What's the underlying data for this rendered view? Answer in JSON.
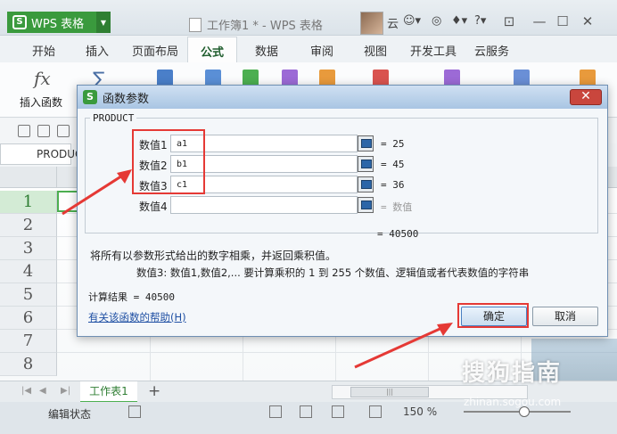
{
  "app": {
    "name": "WPS 表格",
    "window_title": "工作簿1 * - WPS 表格",
    "user_initial": "云"
  },
  "ribbon_tabs": [
    "开始",
    "插入",
    "页面布局",
    "公式",
    "数据",
    "审阅",
    "视图",
    "开发工具",
    "云服务"
  ],
  "active_tab": "公式",
  "ribbon": {
    "insert_function_label": "插入函数"
  },
  "name_box": "PRODUC",
  "rows": [
    "1",
    "2",
    "3",
    "4",
    "5",
    "6",
    "7",
    "8"
  ],
  "sheet_tab": "工作表1",
  "status": {
    "mode": "编辑状态",
    "zoom": "150 %"
  },
  "watermark": {
    "brand": "搜狗指南",
    "url": "zhinan.sogou.com"
  },
  "dialog": {
    "title": "函数参数",
    "function_name": "PRODUCT",
    "args": [
      {
        "label": "数值1",
        "value": "a1",
        "result": "= 25"
      },
      {
        "label": "数值2",
        "value": "b1",
        "result": "= 45"
      },
      {
        "label": "数值3",
        "value": "c1",
        "result": "= 36"
      },
      {
        "label": "数值4",
        "value": "",
        "result": "= 数值"
      }
    ],
    "total": "= 40500",
    "description": "将所有以参数形式给出的数字相乘，并返回乘积值。",
    "arg_description": "数值3:  数值1,数值2,... 要计算乘积的 1 到 255 个数值、逻辑值或者代表数值的字符串",
    "result_line": "计算结果 = 40500",
    "help_link": "有关该函数的帮助(H)",
    "ok": "确定",
    "cancel": "取消"
  },
  "colors": {
    "wps_green": "#3a9a3d",
    "highlight_red": "#e53935",
    "link_blue": "#1e4fa3"
  }
}
